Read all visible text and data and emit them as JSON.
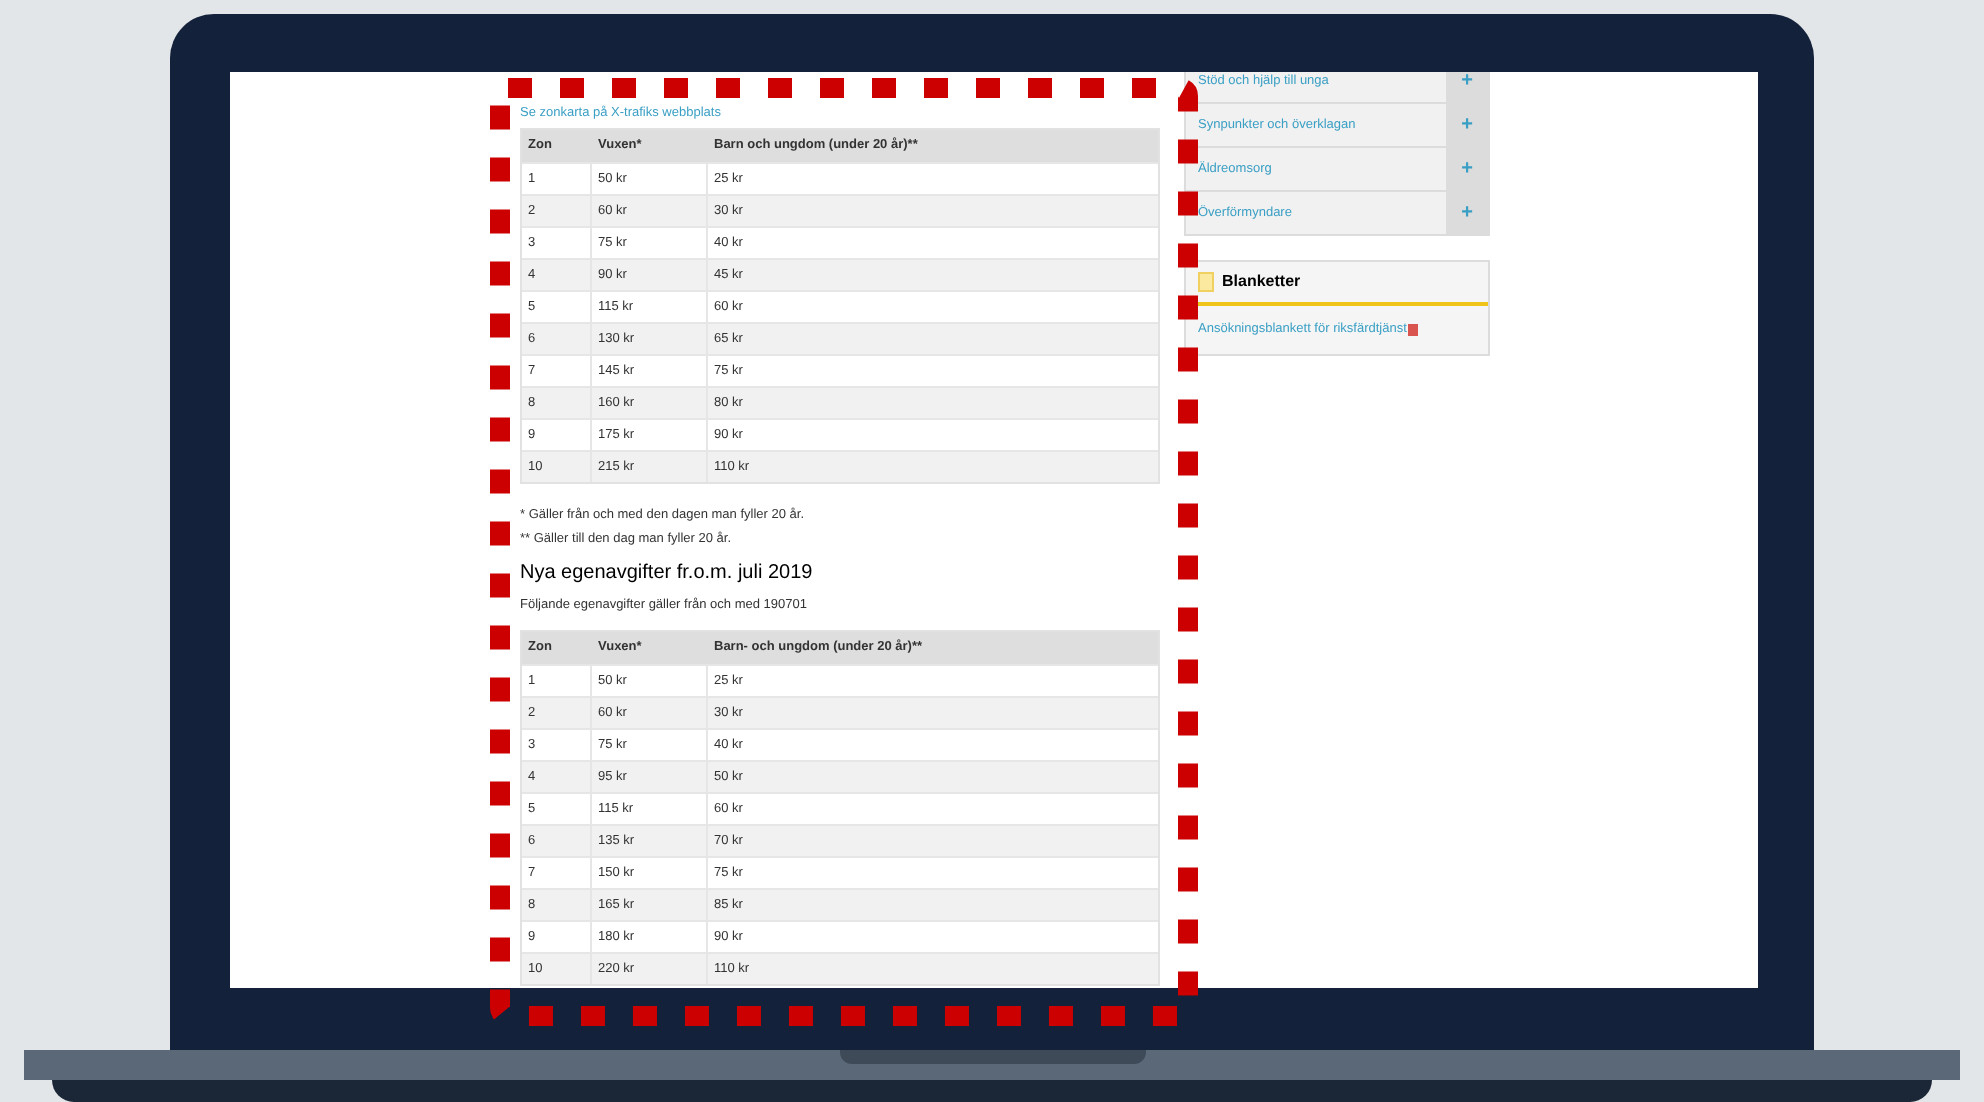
{
  "page": {
    "zone_map_link": "Se zonkarta på X-trafiks webbplats",
    "table_1": {
      "columns": [
        "Zon",
        "Vuxen*",
        "Barn och ungdom (under 20 år)**"
      ],
      "rows": [
        [
          "1",
          "50 kr",
          "25 kr"
        ],
        [
          "2",
          "60 kr",
          "30 kr"
        ],
        [
          "3",
          "75 kr",
          "40 kr"
        ],
        [
          "4",
          "90 kr",
          "45 kr"
        ],
        [
          "5",
          "115 kr",
          "60 kr"
        ],
        [
          "6",
          "130 kr",
          "65 kr"
        ],
        [
          "7",
          "145 kr",
          "75 kr"
        ],
        [
          "8",
          "160 kr",
          "80 kr"
        ],
        [
          "9",
          "175 kr",
          "90 kr"
        ],
        [
          "10",
          "215 kr",
          "110 kr"
        ]
      ]
    },
    "footnotes": [
      "* Gäller från och med den dagen man fyller 20 år.",
      "** Gäller till den dag man fyller 20 år."
    ],
    "heading": "Nya egenavgifter fr.o.m. juli 2019",
    "intro": "Följande egenavgifter gäller från och med 190701",
    "table_2": {
      "columns": [
        "Zon",
        "Vuxen*",
        "Barn- och ungdom (under 20 år)**"
      ],
      "rows": [
        [
          "1",
          "50 kr",
          "25 kr"
        ],
        [
          "2",
          "60 kr",
          "30 kr"
        ],
        [
          "3",
          "75 kr",
          "40 kr"
        ],
        [
          "4",
          "95 kr",
          "50 kr"
        ],
        [
          "5",
          "115 kr",
          "60 kr"
        ],
        [
          "6",
          "135 kr",
          "70 kr"
        ],
        [
          "7",
          "150 kr",
          "75 kr"
        ],
        [
          "8",
          "165 kr",
          "85 kr"
        ],
        [
          "9",
          "180 kr",
          "90 kr"
        ],
        [
          "10",
          "220 kr",
          "110 kr"
        ]
      ]
    }
  },
  "sidebar": {
    "menu": [
      {
        "label": "Stöd och hjälp till unga",
        "toggle": "+"
      },
      {
        "label": "Synpunkter och överklagan",
        "toggle": "+"
      },
      {
        "label": "Äldreomsorg",
        "toggle": "+"
      },
      {
        "label": "Överförmyndare",
        "toggle": "+"
      }
    ],
    "forms_box": {
      "title": "Blanketter",
      "links": [
        "Ansökningsblankett för riksfärdtjänst"
      ]
    }
  }
}
